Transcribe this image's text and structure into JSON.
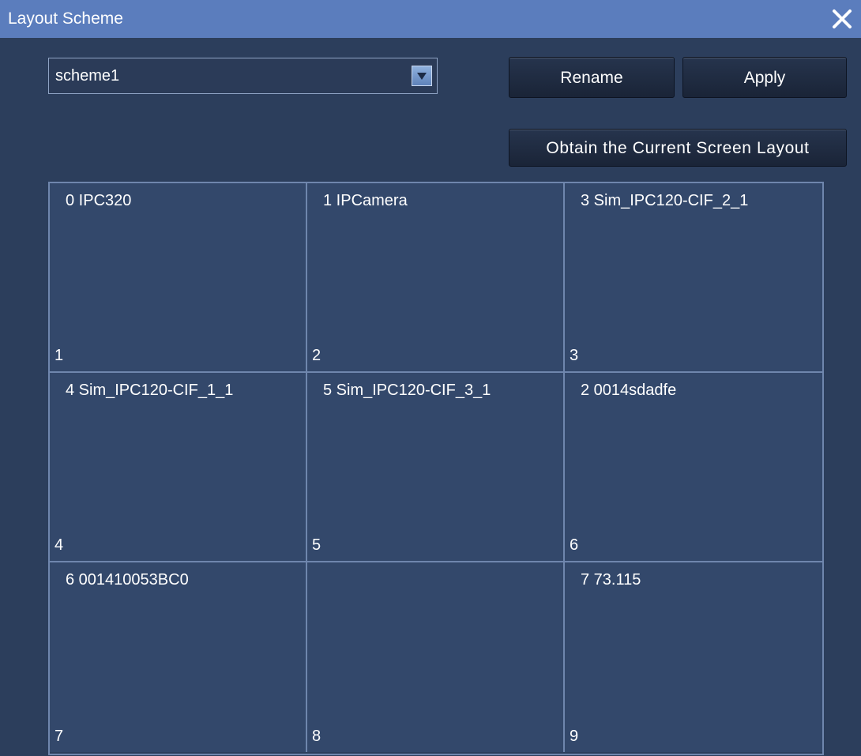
{
  "window": {
    "title": "Layout Scheme",
    "close_icon": "close-icon"
  },
  "scheme": {
    "selected": "scheme1",
    "arrow_icon": "chevron-down-icon"
  },
  "buttons": {
    "rename": "Rename",
    "apply": "Apply",
    "obtain": "Obtain the Current Screen Layout"
  },
  "grid": {
    "cells": [
      {
        "label": "0  IPC320",
        "index": "1"
      },
      {
        "label": "1  IPCamera",
        "index": "2"
      },
      {
        "label": "3  Sim_IPC120-CIF_2_1",
        "index": "3"
      },
      {
        "label": "4  Sim_IPC120-CIF_1_1",
        "index": "4"
      },
      {
        "label": "5  Sim_IPC120-CIF_3_1",
        "index": "5"
      },
      {
        "label": "2  0014sdadfe",
        "index": "6"
      },
      {
        "label": "6  001410053BC0",
        "index": "7"
      },
      {
        "label": "",
        "index": "8"
      },
      {
        "label": "7  73.115",
        "index": "9"
      }
    ]
  },
  "colors": {
    "titlebar": "#5b7dbd",
    "background": "#2c3e5c",
    "cell": "#33486b",
    "grid_line": "#6f86ad"
  }
}
